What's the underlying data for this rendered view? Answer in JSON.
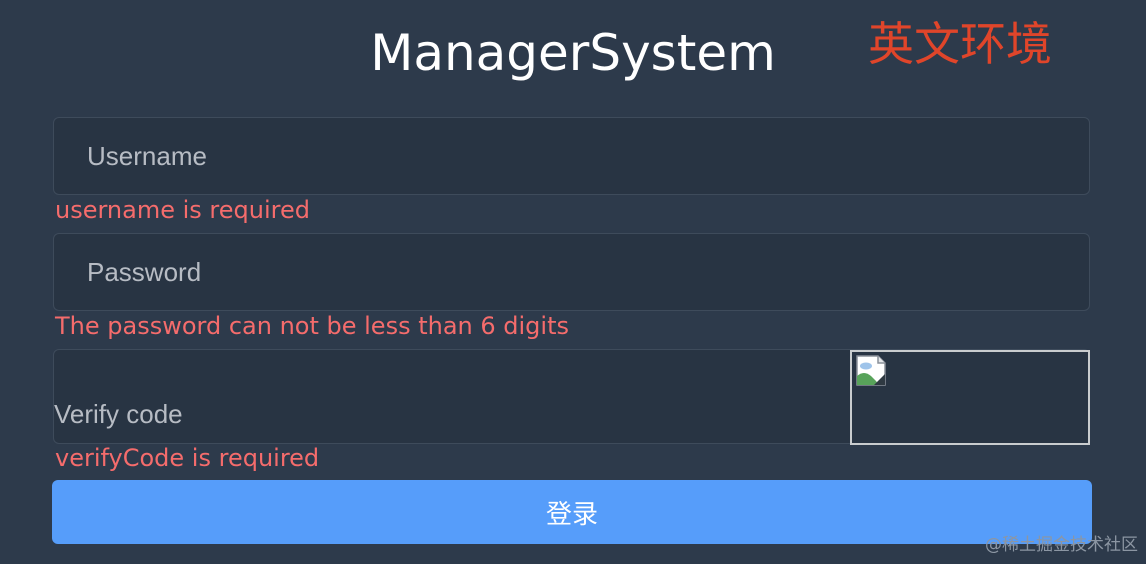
{
  "header": {
    "title": "ManagerSystem",
    "annotation": "英文环境"
  },
  "form": {
    "username": {
      "value": "",
      "placeholder": "Username",
      "error": "username is required"
    },
    "password": {
      "value": "",
      "placeholder": "Password",
      "error": "The password can not be less than 6 digits"
    },
    "verify_code": {
      "value": "",
      "placeholder": "Verify code",
      "error": "verifyCode is required"
    },
    "captcha": {
      "icon": "broken-image-icon"
    },
    "submit_label": "登录"
  },
  "watermark": "@稀土掘金技术社区",
  "colors": {
    "background": "#2d3a4b",
    "input_background": "#283443",
    "error": "#f56c6c",
    "button": "#569dfa",
    "annotation": "#e0452a"
  }
}
